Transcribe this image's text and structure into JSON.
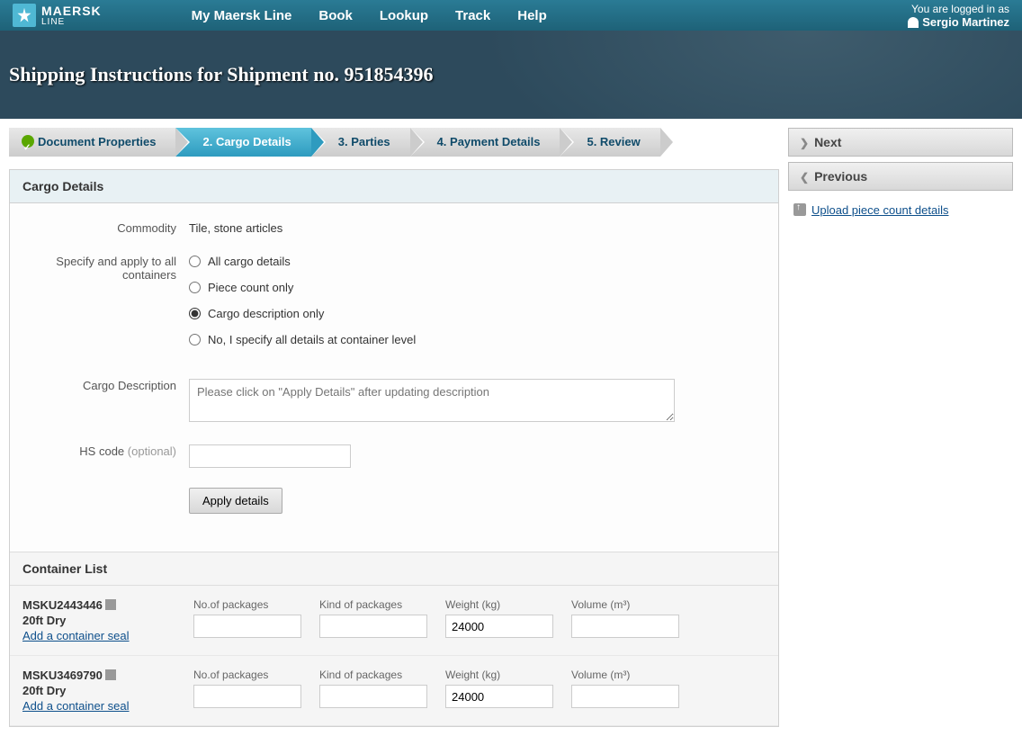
{
  "header": {
    "brand": "MAERSK",
    "brand_sub": "LINE",
    "nav": [
      "My Maersk Line",
      "Book",
      "Lookup",
      "Track",
      "Help"
    ],
    "logged_in_as": "You are logged in as",
    "user_name": "Sergio Martinez"
  },
  "hero": {
    "title": "Shipping Instructions for Shipment no. 951854396"
  },
  "wizard": {
    "steps": [
      {
        "label": "Document Properties",
        "status": "done"
      },
      {
        "label": "2.  Cargo Details",
        "status": "active"
      },
      {
        "label": "3.  Parties",
        "status": ""
      },
      {
        "label": "4.  Payment Details",
        "status": ""
      },
      {
        "label": "5.  Review",
        "status": ""
      }
    ]
  },
  "side": {
    "next": "Next",
    "previous": "Previous",
    "upload_link": "Upload piece count details"
  },
  "panel": {
    "title": "Cargo Details",
    "commodity_label": "Commodity",
    "commodity_value": "Tile, stone articles",
    "specify_label": "Specify and apply to all containers",
    "radios": [
      "All cargo details",
      "Piece count only",
      "Cargo description only",
      "No, I specify all details at container level"
    ],
    "radio_selected_index": 2,
    "cargo_desc_label": "Cargo Description",
    "cargo_desc_placeholder": "Please click on \"Apply Details\" after updating description",
    "hs_label": "HS code",
    "hs_optional": "(optional)",
    "apply_btn": "Apply details"
  },
  "container_list": {
    "title": "Container List",
    "col_packages": "No.of packages",
    "col_kind": "Kind of packages",
    "col_weight": "Weight (kg)",
    "col_volume": "Volume (m³)",
    "seal_link": "Add a container seal",
    "rows": [
      {
        "number": "MSKU2443446",
        "type": "20ft Dry",
        "weight": "24000"
      },
      {
        "number": "MSKU3469790",
        "type": "20ft Dry",
        "weight": "24000"
      }
    ]
  }
}
